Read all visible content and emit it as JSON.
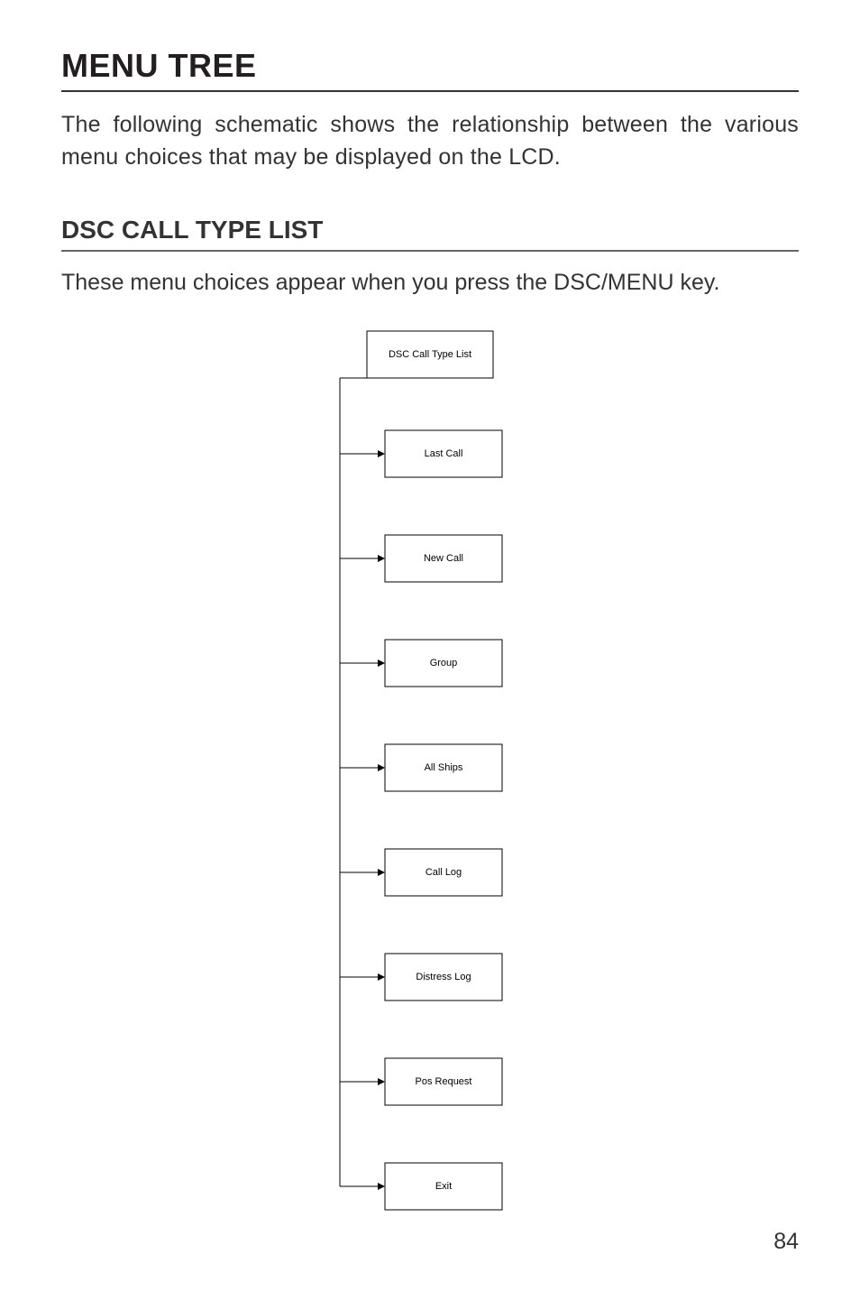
{
  "section_title": "MENU TREE",
  "intro_text": "The following schematic shows the relationship between the various menu choices that may be displayed on the LCD.",
  "sub_title": "DSC CALL TYPE LIST",
  "sub_intro": "These menu choices appear when you press the DSC/MENU key.",
  "tree": {
    "root": "DSC Call Type List",
    "items": [
      "Last Call",
      "New Call",
      "Group",
      "All Ships",
      "Call Log",
      "Distress Log",
      "Pos Request",
      "Exit"
    ]
  },
  "page_number": "84"
}
